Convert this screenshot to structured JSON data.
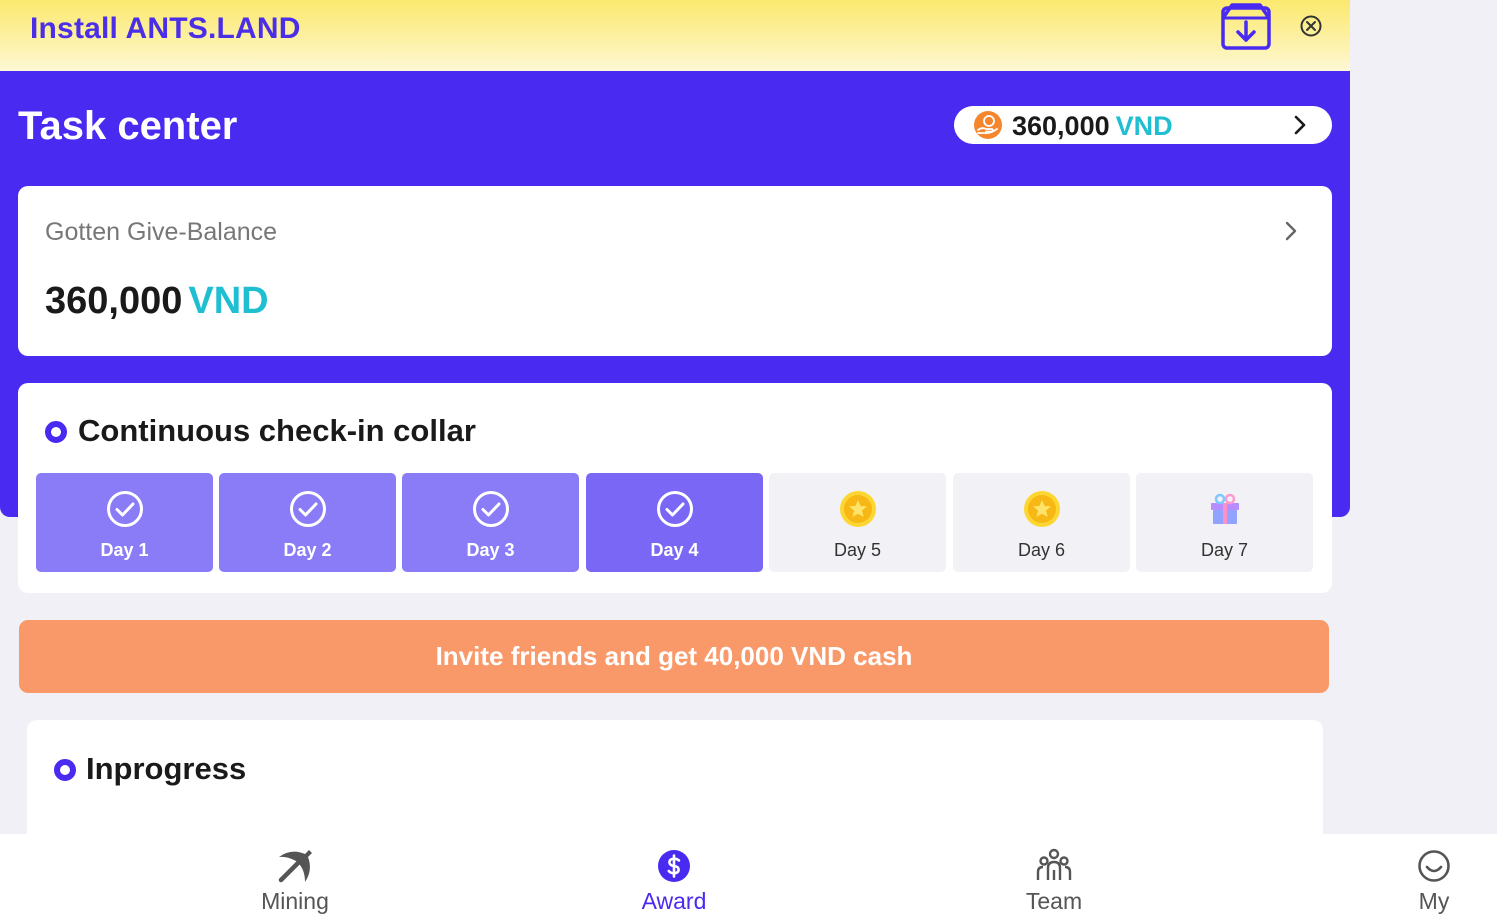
{
  "banner": {
    "title": "Install ANTS.LAND"
  },
  "header": {
    "title": "Task center",
    "pill_amount": "360,000",
    "pill_currency": "VND"
  },
  "balance_card": {
    "label": "Gotten Give-Balance",
    "amount": "360,000",
    "currency": "VND"
  },
  "checkin": {
    "title": "Continuous check-in collar",
    "days": [
      {
        "label": "Day 1",
        "state": "done",
        "icon": "check-circle-icon"
      },
      {
        "label": "Day 2",
        "state": "done",
        "icon": "check-circle-icon"
      },
      {
        "label": "Day 3",
        "state": "done",
        "icon": "check-circle-icon"
      },
      {
        "label": "Day 4",
        "state": "done",
        "icon": "check-circle-icon"
      },
      {
        "label": "Day 5",
        "state": "todo",
        "icon": "coin-icon"
      },
      {
        "label": "Day 6",
        "state": "todo",
        "icon": "coin-icon"
      },
      {
        "label": "Day 7",
        "state": "todo",
        "icon": "gift-icon"
      }
    ]
  },
  "invite": {
    "label": "Invite friends and get 40,000 VND cash"
  },
  "progress": {
    "title": "Inprogress"
  },
  "nav": {
    "items": [
      {
        "label": "Mining",
        "icon": "pickaxe-icon",
        "active": false
      },
      {
        "label": "Award",
        "icon": "dollar-icon",
        "active": true
      },
      {
        "label": "Team",
        "icon": "team-icon",
        "active": false
      },
      {
        "label": "My",
        "icon": "smile-icon",
        "active": false
      }
    ]
  },
  "colors": {
    "brand_purple": "#482af1",
    "accent_cyan": "#1fbfd1",
    "invite_orange": "#f9996a",
    "day_done": "#8a7bf7",
    "banner_yellow": "#fbe96e"
  }
}
